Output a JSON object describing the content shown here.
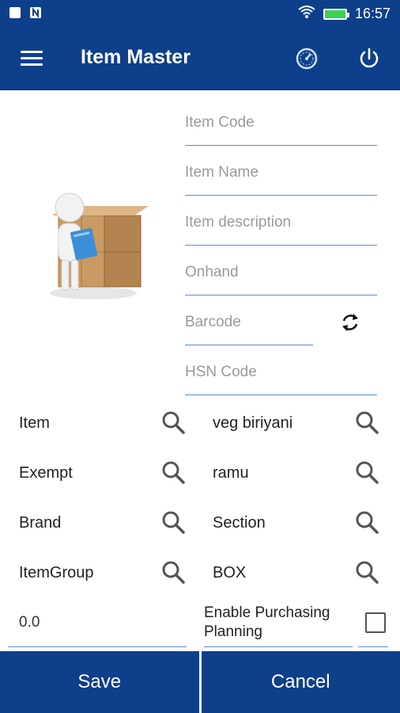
{
  "status_bar": {
    "time": "16:57",
    "icons": [
      "image-icon",
      "n-notification-icon",
      "wifi-icon",
      "battery-charging-icon"
    ],
    "battery_color": "#3ad24f"
  },
  "app_bar": {
    "title": "Item Master",
    "background": "#0e3f8a",
    "icons": [
      "menu-icon",
      "speedometer-icon",
      "power-icon"
    ]
  },
  "form": {
    "item_code": {
      "placeholder": "Item Code",
      "value": ""
    },
    "item_name": {
      "placeholder": "Item Name",
      "value": ""
    },
    "item_description": {
      "placeholder": "Item description",
      "value": ""
    },
    "onhand": {
      "placeholder": "Onhand",
      "value": ""
    },
    "barcode": {
      "placeholder": "Barcode",
      "value": ""
    },
    "hsn_code": {
      "placeholder": "HSN Code",
      "value": ""
    }
  },
  "lookups": {
    "left": [
      {
        "label": "Item"
      },
      {
        "label": "Exempt"
      },
      {
        "label": "Brand"
      },
      {
        "label": "ItemGroup"
      }
    ],
    "right": [
      {
        "label": "veg biriyani"
      },
      {
        "label": "ramu"
      },
      {
        "label": "Section"
      },
      {
        "label": "BOX"
      }
    ]
  },
  "extra": {
    "numeric_value": "0.0",
    "enable_purchasing_planning_label": "Enable Purchasing Planning",
    "enable_purchasing_planning_checked": false
  },
  "actions": {
    "save_label": "Save",
    "cancel_label": "Cancel"
  },
  "colors": {
    "primary": "#0e3f8a",
    "underline": "#5a8bd6"
  }
}
